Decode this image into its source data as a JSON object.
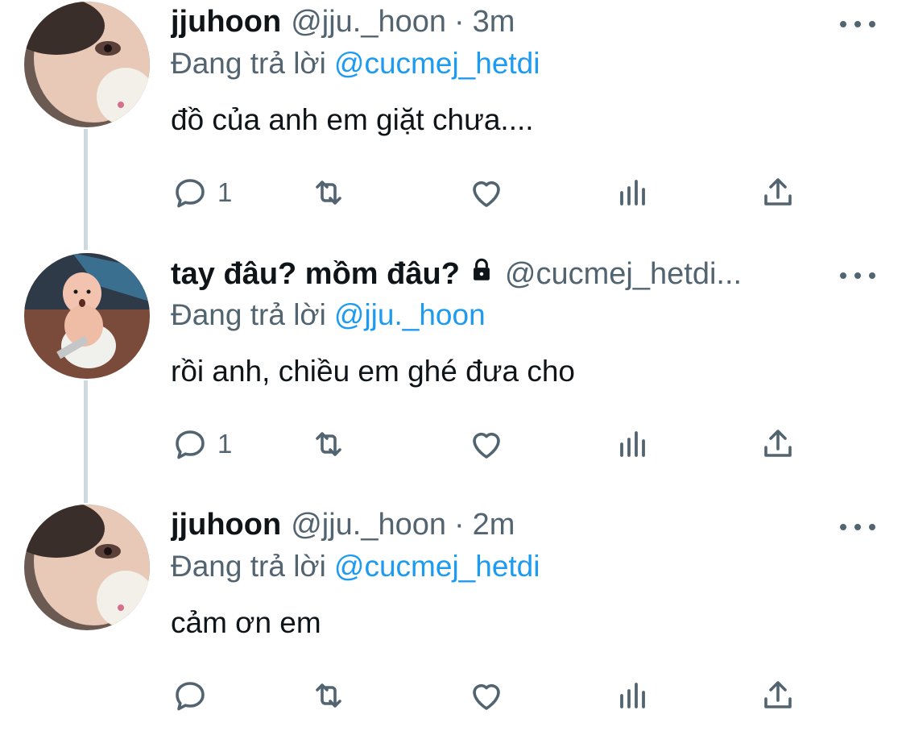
{
  "tweets": [
    {
      "name": "jjuhoon",
      "handle": "@jju._hoon",
      "separator": "·",
      "time": "3m",
      "replying_prefix": "Đang trả lời",
      "replying_to": "@cucmej_hetdi",
      "text": "đồ của anh em giặt chưa....",
      "reply_count": "1",
      "avatar": "photo-person",
      "protected": false
    },
    {
      "name": "tay đâu? mồm đâu?",
      "handle": "@cucmej_hetdi...",
      "separator": "",
      "time": "",
      "replying_prefix": "Đang trả lời",
      "replying_to": "@jju._hoon",
      "text": "rồi anh, chiều em ghé đưa cho",
      "reply_count": "1",
      "avatar": "photo-baby",
      "protected": true
    },
    {
      "name": "jjuhoon",
      "handle": "@jju._hoon",
      "separator": "·",
      "time": "2m",
      "replying_prefix": "Đang trả lời",
      "replying_to": "@cucmej_hetdi",
      "text": "cảm ơn em",
      "reply_count": "",
      "avatar": "photo-person",
      "protected": false
    }
  ],
  "icons": {
    "reply": "reply-bubble-icon",
    "retweet": "retweet-icon",
    "like": "heart-icon",
    "stats": "bar-chart-icon",
    "share": "share-upload-icon",
    "more": "more-dots-icon",
    "lock": "lock-icon"
  },
  "colors": {
    "text": "#0f1419",
    "secondary": "#536471",
    "link": "#1d9bf0",
    "thread_line": "#cfd9de"
  }
}
